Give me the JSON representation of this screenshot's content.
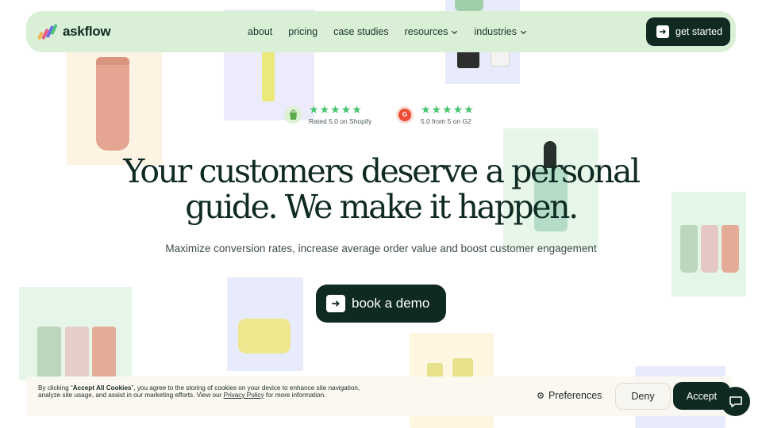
{
  "brand": {
    "name": "askflow"
  },
  "nav": {
    "items": [
      {
        "label": "about",
        "dropdown": false
      },
      {
        "label": "pricing",
        "dropdown": false
      },
      {
        "label": "case studies",
        "dropdown": false
      },
      {
        "label": "resources",
        "dropdown": true
      },
      {
        "label": "industries",
        "dropdown": true
      }
    ],
    "cta_label": "get started"
  },
  "ratings": [
    {
      "source_icon": "shopify-icon",
      "stars": 5,
      "text": "Rated 5.0 on Shopify"
    },
    {
      "source_icon": "g2-icon",
      "stars": 5,
      "text": "5.0 from 5 on G2"
    }
  ],
  "hero": {
    "headline_line1": "Your customers deserve a personal",
    "headline_line2": "guide. We make it happen.",
    "subline": "Maximize conversion rates, increase average order value and boost customer engagement",
    "cta_label": "book a demo"
  },
  "cookie": {
    "text_prefix": "By clicking “",
    "text_bold": "Accept All Cookies",
    "text_middle": "”, you agree to the storing of cookies on your device to enhance site navigation, analyze site usage, and assist in our marketing efforts. View our ",
    "policy_link": "Privacy Policy",
    "text_suffix": " for more information.",
    "preferences_label": "Preferences",
    "deny_label": "Deny",
    "accept_label": "Accept"
  },
  "colors": {
    "nav_bg": "#d9efd6",
    "dark_green": "#0f2a22",
    "star_green": "#44c56a"
  }
}
